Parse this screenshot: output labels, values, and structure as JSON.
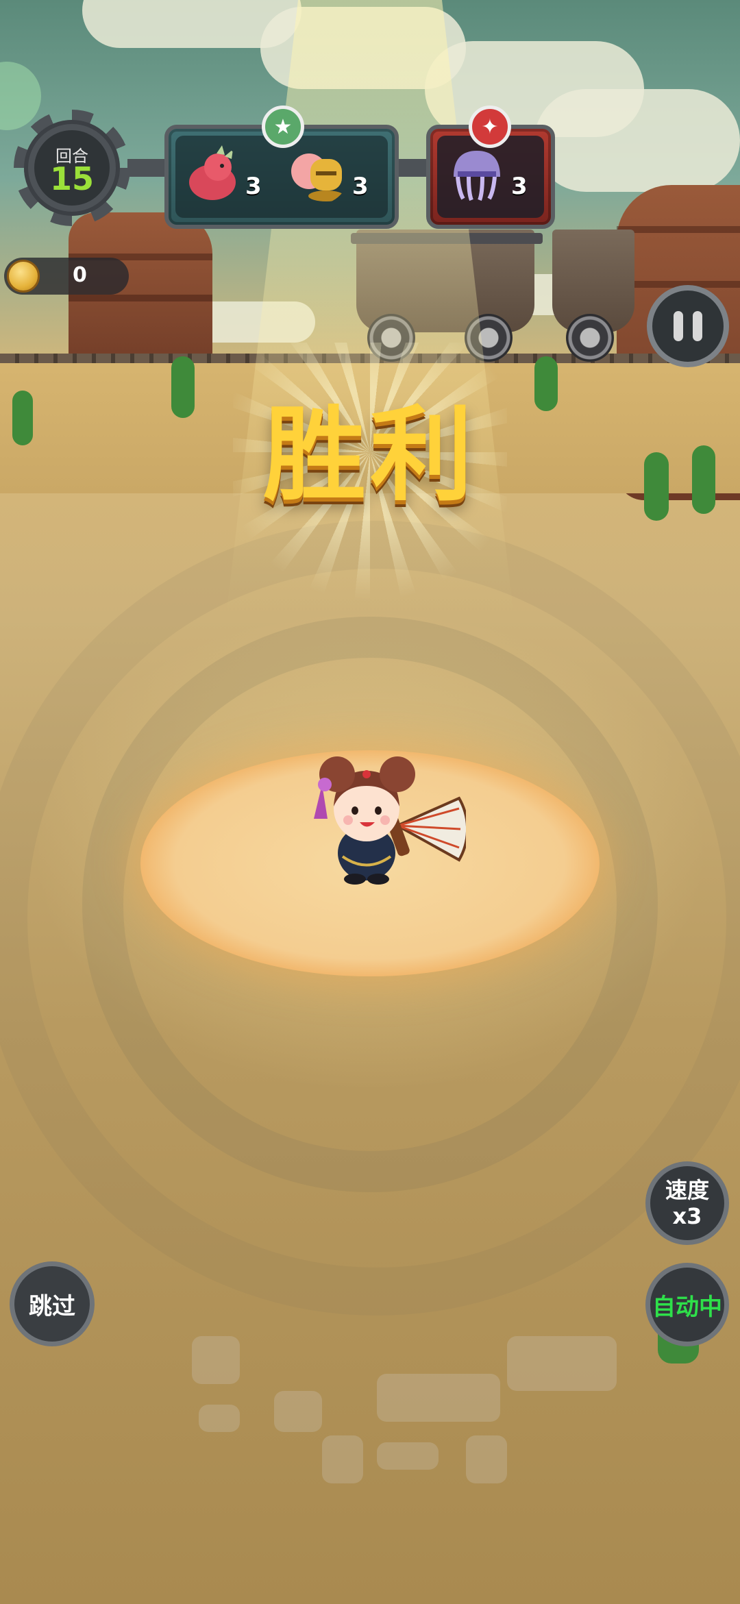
{
  "hud": {
    "round_label": "回合",
    "round_number": "15"
  },
  "ally_team": {
    "units": [
      {
        "icon": "red-dragon-icon",
        "count": "3"
      },
      {
        "icon": "golden-knight-icon",
        "count": "3"
      }
    ],
    "badge_icon": "green-star-icon"
  },
  "enemy_team": {
    "units": [
      {
        "icon": "purple-jellyfish-icon",
        "count": "3"
      }
    ],
    "badge_icon": "red-compass-star-icon"
  },
  "coins": {
    "value": "0"
  },
  "result": {
    "text": "胜利"
  },
  "controls": {
    "speed_label": "速度",
    "speed_value": "x3",
    "auto_label": "自动中",
    "skip_label": "跳过"
  },
  "colors": {
    "victory_text": "#ffd23a",
    "round_number": "#9be03a",
    "auto_active": "#2ee04a",
    "ally_panel": "#3f6f73",
    "enemy_panel": "#b13a30"
  }
}
